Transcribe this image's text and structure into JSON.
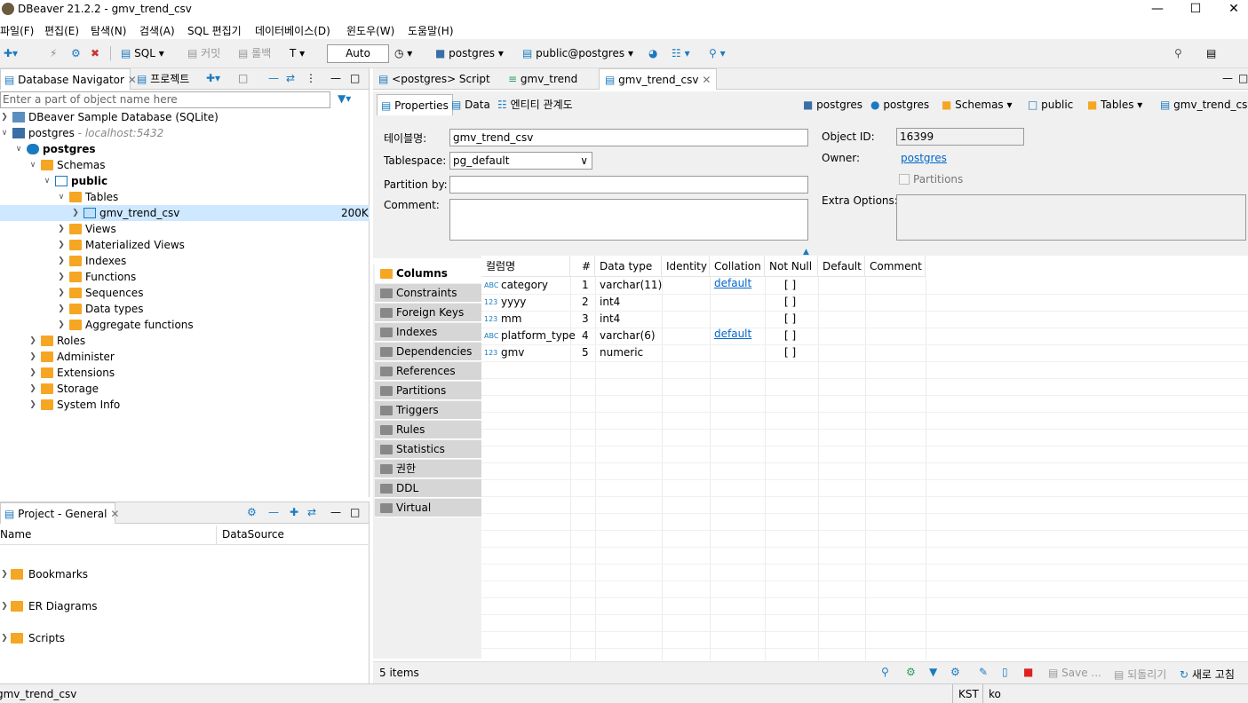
{
  "window": {
    "title": "DBeaver 21.2.2 - gmv_trend_csv"
  },
  "menu": [
    "파일(F)",
    "편집(E)",
    "탐색(N)",
    "검색(A)",
    "SQL 편집기",
    "데이터베이스(D)",
    "윈도우(W)",
    "도움말(H)"
  ],
  "toolbar": {
    "sql": "SQL",
    "commit": "커밋",
    "rollback": "롤백",
    "tx_mode": "Auto",
    "datasource": "postgres",
    "schema": "public@postgres"
  },
  "navigator": {
    "tab_label": "Database Navigator",
    "project_tab": "프로젝트",
    "filter_placeholder": "Enter a part of object name here",
    "nodes": [
      {
        "label": "DBeaver Sample Database (SQLite)"
      },
      {
        "label": "postgres",
        "hint": "- localhost:5432"
      },
      {
        "label": "postgres"
      },
      {
        "label": "Schemas"
      },
      {
        "label": "public"
      },
      {
        "label": "Tables"
      },
      {
        "label": "gmv_trend_csv",
        "size": "200K"
      },
      {
        "label": "Views"
      },
      {
        "label": "Materialized Views"
      },
      {
        "label": "Indexes"
      },
      {
        "label": "Functions"
      },
      {
        "label": "Sequences"
      },
      {
        "label": "Data types"
      },
      {
        "label": "Aggregate functions"
      },
      {
        "label": "Roles"
      },
      {
        "label": "Administer"
      },
      {
        "label": "Extensions"
      },
      {
        "label": "Storage"
      },
      {
        "label": "System Info"
      }
    ]
  },
  "project": {
    "tab_label": "Project - General",
    "col_name": "Name",
    "col_datasource": "DataSource",
    "items": [
      "Bookmarks",
      "ER Diagrams",
      "Scripts"
    ]
  },
  "editor": {
    "tabs": [
      "<postgres> Script",
      "gmv_trend",
      "gmv_trend_csv"
    ],
    "subtabs": [
      "Properties",
      "Data",
      "엔티티 관계도"
    ],
    "breadcrumb": [
      "postgres",
      "postgres",
      "Schemas",
      "public",
      "Tables",
      "gmv_trend_csv"
    ],
    "props": {
      "table_name_label": "테이블명:",
      "table_name": "gmv_trend_csv",
      "tablespace_label": "Tablespace:",
      "tablespace": "pg_default",
      "partition_label": "Partition by:",
      "comment_label": "Comment:",
      "object_id_label": "Object ID:",
      "object_id": "16399",
      "owner_label": "Owner:",
      "owner": "postgres",
      "partitions_label": "Partitions",
      "extra_label": "Extra Options:"
    },
    "side_items": [
      "Columns",
      "Constraints",
      "Foreign Keys",
      "Indexes",
      "Dependencies",
      "References",
      "Partitions",
      "Triggers",
      "Rules",
      "Statistics",
      "권한",
      "DDL",
      "Virtual"
    ],
    "grid": {
      "headers": [
        "컬럼명",
        "#",
        "Data type",
        "Identity",
        "Collation",
        "Not Null",
        "Default",
        "Comment"
      ],
      "rows": [
        {
          "type_icon": "ABC",
          "name": "category",
          "num": "1",
          "dtype": "varchar(11)",
          "collation": "default",
          "notnull": "[ ]"
        },
        {
          "type_icon": "123",
          "name": "yyyy",
          "num": "2",
          "dtype": "int4",
          "collation": "",
          "notnull": "[ ]"
        },
        {
          "type_icon": "123",
          "name": "mm",
          "num": "3",
          "dtype": "int4",
          "collation": "",
          "notnull": "[ ]"
        },
        {
          "type_icon": "ABC",
          "name": "platform_type",
          "num": "4",
          "dtype": "varchar(6)",
          "collation": "default",
          "notnull": "[ ]"
        },
        {
          "type_icon": "123",
          "name": "gmv",
          "num": "5",
          "dtype": "numeric",
          "collation": "",
          "notnull": "[ ]"
        }
      ]
    },
    "footer": {
      "count": "5 items",
      "save": "Save ...",
      "revert": "되돌리기",
      "refresh": "새로 고침"
    }
  },
  "status": {
    "left": "gmv_trend_csv",
    "tz": "KST",
    "lang": "ko"
  }
}
